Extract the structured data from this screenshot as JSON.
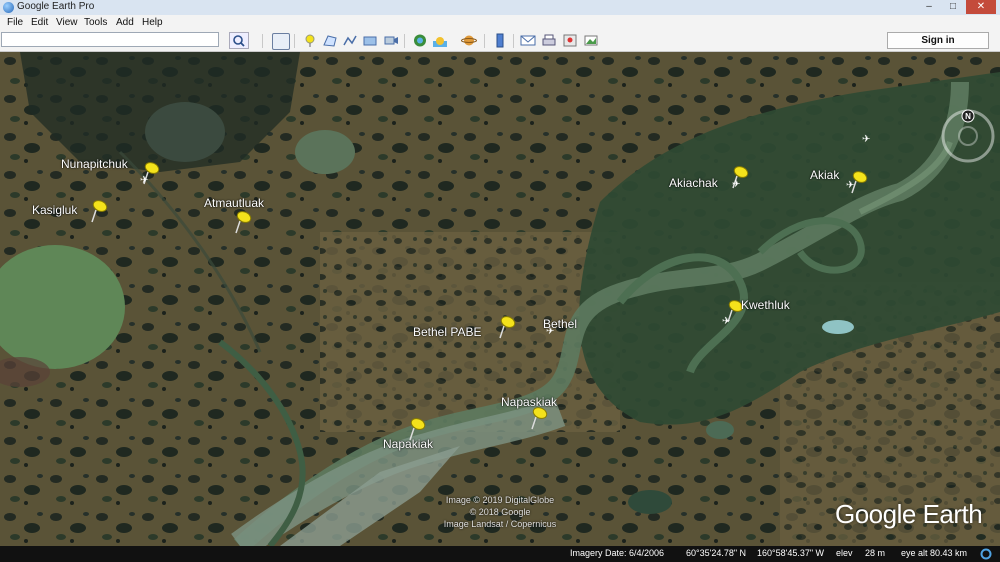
{
  "window": {
    "title": "Google Earth Pro"
  },
  "menubar": {
    "items": [
      "File",
      "Edit",
      "View",
      "Tools",
      "Add",
      "Help"
    ]
  },
  "toolbar": {
    "search_value": "",
    "sign_in_label": "Sign in",
    "icons": [
      "search-icon",
      "sidebar-toggle-icon",
      "placemark-icon",
      "polygon-icon",
      "path-icon",
      "image-overlay-icon",
      "record-tour-icon",
      "historical-imagery-icon",
      "sunlight-icon",
      "planets-icon",
      "ruler-icon",
      "email-icon",
      "print-icon",
      "google-maps-icon",
      "save-image-icon"
    ]
  },
  "compass": {
    "north_label": "N"
  },
  "placemarks": [
    {
      "name": "Nunapitchuk"
    },
    {
      "name": "Kasigluk"
    },
    {
      "name": "Atmautluak"
    },
    {
      "name": "Akiachak"
    },
    {
      "name": "Akiak"
    },
    {
      "name": "Kwethluk"
    },
    {
      "name": "Bethel PABE"
    },
    {
      "name": "Bethel"
    },
    {
      "name": "Napaskiak"
    },
    {
      "name": "Napakiak"
    }
  ],
  "attribution": {
    "line1": "Image © 2019 DigitalGlobe",
    "line2": "© 2018 Google",
    "line3": "Image Landsat / Copernicus"
  },
  "logo": {
    "text": "Google Earth"
  },
  "status": {
    "imagery_date": "Imagery Date: 6/4/2006",
    "lat": "60°35'24.78\" N",
    "lon": "160°58'45.37\" W",
    "elev_label": "elev",
    "elev_value": "28 m",
    "eye_alt": "eye alt 80.43 km"
  },
  "colors": {
    "pin": "#f4e21b",
    "terrain": "#4b4a30",
    "water": "#3f6b4a"
  }
}
